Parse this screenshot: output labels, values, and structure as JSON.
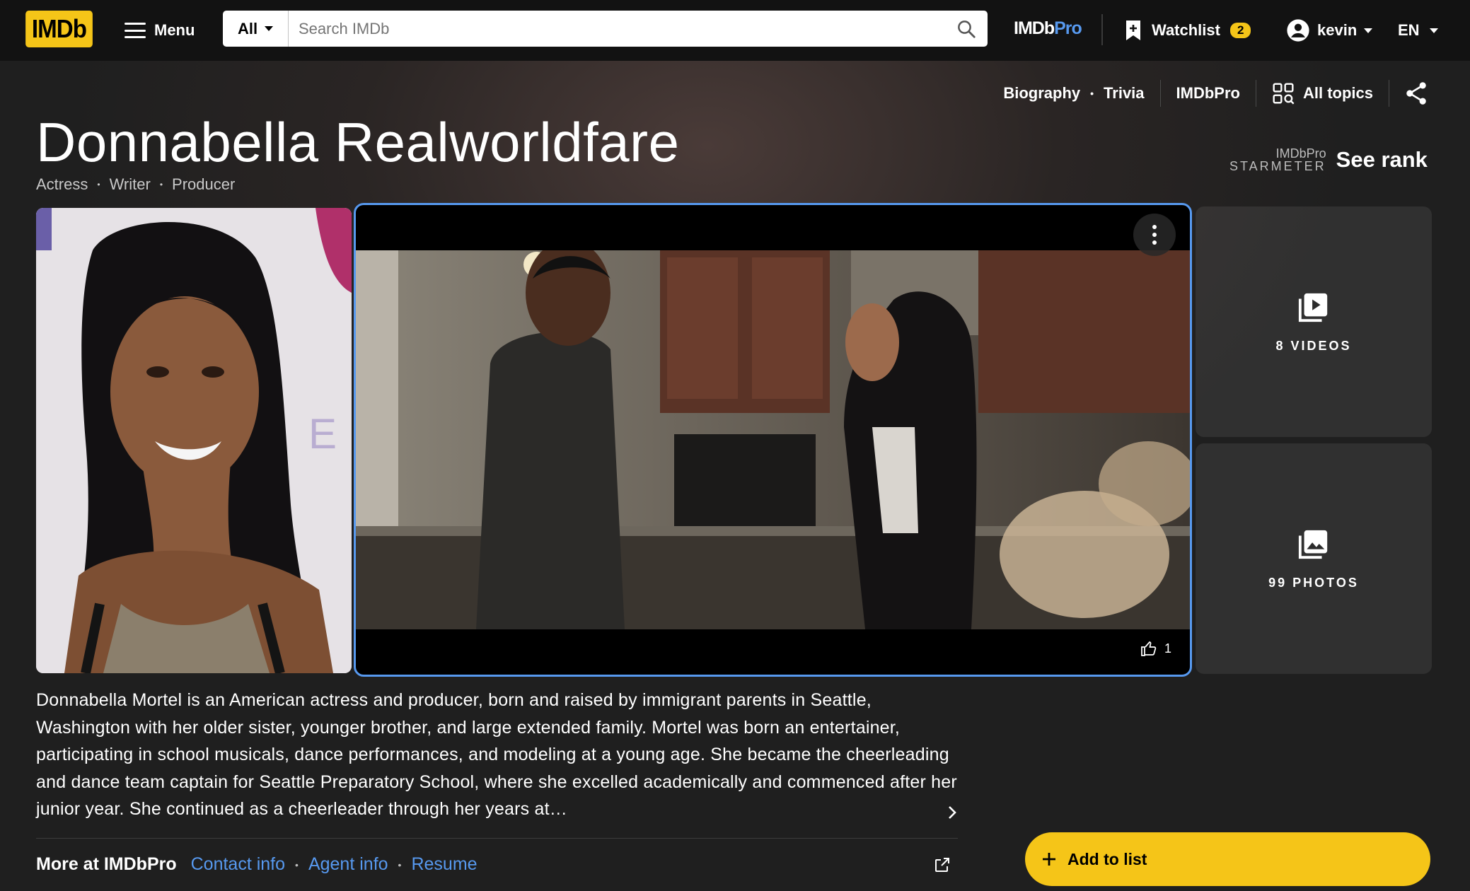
{
  "nav": {
    "logo": "IMDb",
    "menu_label": "Menu",
    "search_category": "All",
    "search_placeholder": "Search IMDb",
    "imdbpro_imdb": "IMDb",
    "imdbpro_pro": "Pro",
    "watchlist_label": "Watchlist",
    "watchlist_count": "2",
    "user_name": "kevin",
    "language": "EN"
  },
  "subnav": {
    "biography": "Biography",
    "trivia": "Trivia",
    "imdbpro": "IMDbPro",
    "all_topics": "All topics"
  },
  "person": {
    "name": "Donnabella Realworldfare",
    "roles": [
      "Actress",
      "Writer",
      "Producer"
    ]
  },
  "starmeter": {
    "pro_label": "IMDbPro",
    "meter_label": "STARMETER",
    "rank_label": "See rank"
  },
  "media": {
    "video_likes": "1",
    "videos_label": "8 VIDEOS",
    "photos_label": "99 PHOTOS"
  },
  "bio": {
    "text": "Donnabella Mortel is an American actress and producer, born and raised by immigrant parents in Seattle, Washington with her older sister, younger brother, and large extended family. Mortel was born an entertainer, participating in school musicals, dance performances, and modeling at a young age. She became the cheerleading and dance team captain for Seattle Preparatory School, where she excelled academically and commenced after her junior year. She continued as a cheerleader through her years at…"
  },
  "more_pro": {
    "lead": "More at IMDbPro",
    "links": [
      "Contact info",
      "Agent info",
      "Resume"
    ]
  },
  "actions": {
    "add_to_list": "Add to list"
  },
  "colors": {
    "brand_yellow": "#f5c518",
    "link_blue": "#5799ef",
    "nav_bg": "#121212"
  }
}
